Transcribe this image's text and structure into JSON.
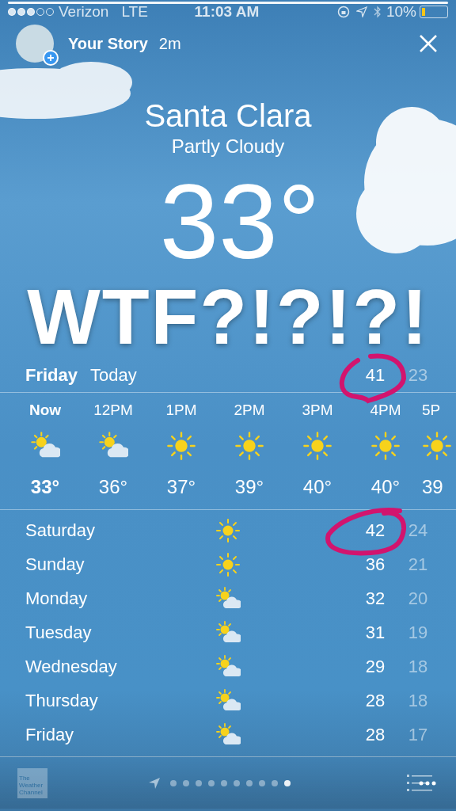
{
  "status_bar": {
    "signal_dots": [
      {
        "filled": true
      },
      {
        "filled": true
      },
      {
        "filled": true
      },
      {
        "filled": false
      },
      {
        "filled": false
      }
    ],
    "carrier": "Verizon",
    "network": "LTE",
    "time": "11:03 AM",
    "battery": "10%"
  },
  "story": {
    "title": "Your Story",
    "age": "2m",
    "progress": {
      "level": 1
    }
  },
  "location": {
    "city": "Santa Clara",
    "condition": "Partly Cloudy",
    "temperature": "33°"
  },
  "caption": "WTF?!?!?!",
  "today": {
    "day": "Friday",
    "label": "Today",
    "high": "41",
    "low": "23"
  },
  "hourly": [
    {
      "time": "Now",
      "kind": "partly-cloudy",
      "temp": "33°",
      "now": true
    },
    {
      "time": "12PM",
      "kind": "partly-cloudy",
      "temp": "36°",
      "now": false
    },
    {
      "time": "1PM",
      "kind": "sunny",
      "temp": "37°",
      "now": false
    },
    {
      "time": "2PM",
      "kind": "sunny",
      "temp": "39°",
      "now": false
    },
    {
      "time": "3PM",
      "kind": "sunny",
      "temp": "40°",
      "now": false
    },
    {
      "time": "4PM",
      "kind": "sunny",
      "temp": "40°",
      "now": false
    },
    {
      "time": "5P",
      "kind": "sunny",
      "temp": "39",
      "now": false
    }
  ],
  "daily": [
    {
      "day": "Saturday",
      "kind": "sunny",
      "high": "42",
      "low": "24"
    },
    {
      "day": "Sunday",
      "kind": "sunny",
      "high": "36",
      "low": "21"
    },
    {
      "day": "Monday",
      "kind": "partly-cloudy",
      "high": "32",
      "low": "20"
    },
    {
      "day": "Tuesday",
      "kind": "partly-cloudy",
      "high": "31",
      "low": "19"
    },
    {
      "day": "Wednesday",
      "kind": "partly-cloudy",
      "high": "29",
      "low": "18"
    },
    {
      "day": "Thursday",
      "kind": "partly-cloudy",
      "high": "28",
      "low": "18"
    },
    {
      "day": "Friday",
      "kind": "partly-cloudy",
      "high": "28",
      "low": "17"
    }
  ],
  "bottom_bar": {
    "logo": "The Weather Channel",
    "pages": [
      {
        "selected": false
      },
      {
        "selected": false
      },
      {
        "selected": false
      },
      {
        "selected": false
      },
      {
        "selected": false
      },
      {
        "selected": false
      },
      {
        "selected": false
      },
      {
        "selected": false
      },
      {
        "selected": false
      },
      {
        "selected": true
      }
    ]
  }
}
